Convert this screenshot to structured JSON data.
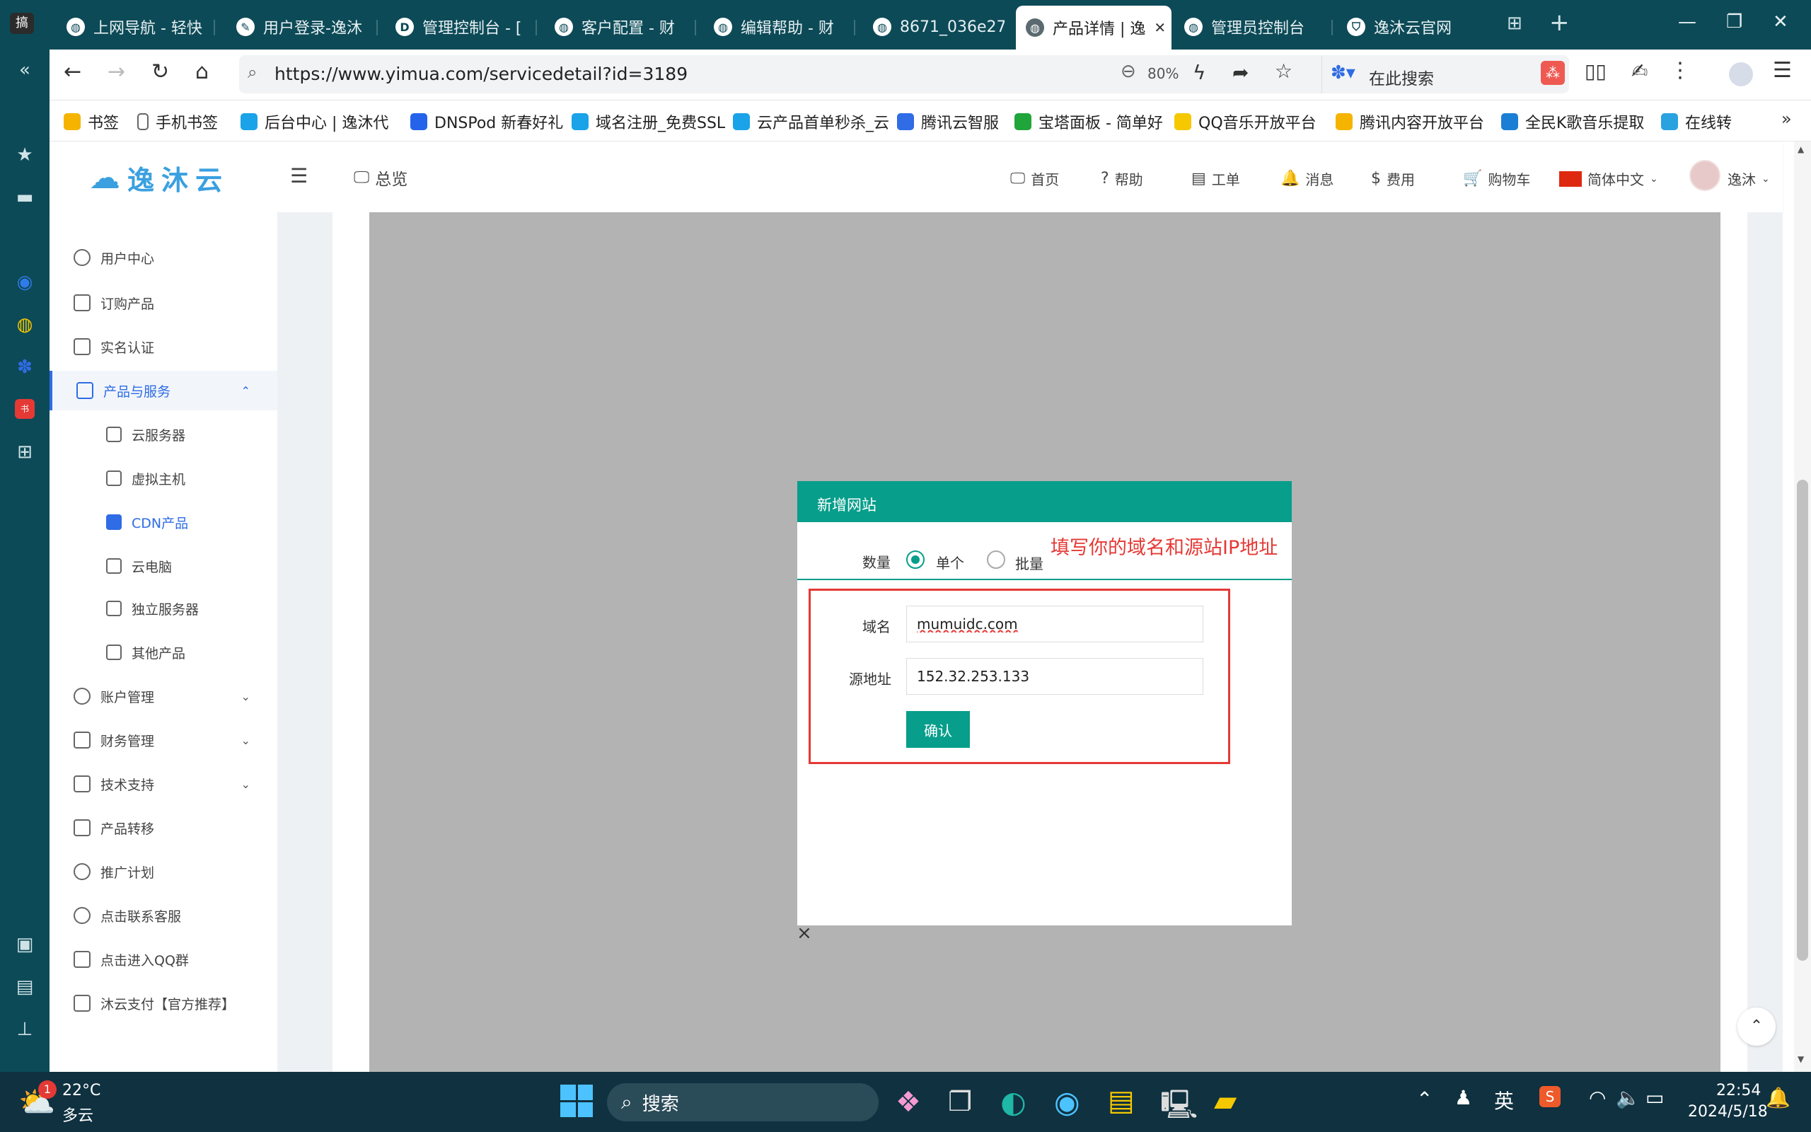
{
  "browser": {
    "tabs": [
      {
        "title": "上网导航 - 轻快",
        "icon": "globe-icon"
      },
      {
        "title": "用户登录-逸沐",
        "icon": "pen-icon"
      },
      {
        "title": "管理控制台 - [",
        "icon": "d-icon"
      },
      {
        "title": "客户配置 - 财",
        "icon": "globe-icon"
      },
      {
        "title": "编辑帮助 - 财",
        "icon": "globe-icon"
      },
      {
        "title": "8671_036e27",
        "icon": "globe-icon"
      },
      {
        "title": "产品详情 | 逸",
        "icon": "globe-icon",
        "active": true
      },
      {
        "title": "管理员控制台",
        "icon": "globe-icon"
      },
      {
        "title": "逸沐云官网",
        "icon": "shield-icon"
      }
    ],
    "url": "https://www.yimua.com/servicedetail?id=3189",
    "zoom": "80%",
    "search_label": "在此搜索",
    "bookmarks": [
      {
        "label": "书签",
        "color": "#f5b400"
      },
      {
        "label": "手机书签",
        "color": "#666666"
      },
      {
        "label": "后台中心 | 逸沐代",
        "color": "#1aa3e8"
      },
      {
        "label": "DNSPod 新春好礼",
        "color": "#2563eb"
      },
      {
        "label": "域名注册_免费SSL",
        "color": "#1aa3e8"
      },
      {
        "label": "云产品首单秒杀_云",
        "color": "#1aa3e8"
      },
      {
        "label": "腾讯云智服",
        "color": "#2f6ce5"
      },
      {
        "label": "宝塔面板 - 简单好",
        "color": "#20a53a"
      },
      {
        "label": "QQ音乐开放平台",
        "color": "#f5c800"
      },
      {
        "label": "腾讯内容开放平台",
        "color": "#f5b400"
      },
      {
        "label": "全民K歌音乐提取",
        "color": "#1a7fd4"
      },
      {
        "label": "在线转",
        "color": "#29a3e0"
      }
    ]
  },
  "site": {
    "logo_text": "逸沐云",
    "overview_label": "总览",
    "header_nav": [
      "首页",
      "帮助",
      "工单",
      "消息",
      "费用",
      "购物车",
      "简体中文"
    ],
    "username": "逸沐",
    "sidebar": [
      {
        "label": "用户中心"
      },
      {
        "label": "订购产品"
      },
      {
        "label": "实名认证"
      },
      {
        "label": "产品与服务",
        "active": true
      },
      {
        "label": "云服务器",
        "sub": true
      },
      {
        "label": "虚拟主机",
        "sub": true
      },
      {
        "label": "CDN产品",
        "sub": true,
        "active": true
      },
      {
        "label": "云电脑",
        "sub": true
      },
      {
        "label": "独立服务器",
        "sub": true
      },
      {
        "label": "其他产品",
        "sub": true
      },
      {
        "label": "账户管理"
      },
      {
        "label": "财务管理"
      },
      {
        "label": "技术支持"
      },
      {
        "label": "产品转移"
      },
      {
        "label": "推广计划"
      },
      {
        "label": "点击联系客服"
      },
      {
        "label": "点击进入QQ群"
      },
      {
        "label": "沐云支付【官方推荐】"
      }
    ]
  },
  "modal": {
    "title": "新增网站",
    "quantity_label": "数量",
    "option_single": "单个",
    "option_batch": "批量",
    "domain_label": "域名",
    "domain_value": "mumuidc.com",
    "origin_label": "源地址",
    "origin_value": "152.32.253.133",
    "confirm_label": "确认",
    "annotation": "填写你的域名和源站IP地址",
    "close_glyph": "×"
  },
  "taskbar": {
    "weather_temp": "22°C",
    "weather_desc": "多云",
    "weather_badge": "1",
    "search_label": "搜索",
    "ime": "英",
    "time": "22:54",
    "date": "2024/5/18"
  }
}
